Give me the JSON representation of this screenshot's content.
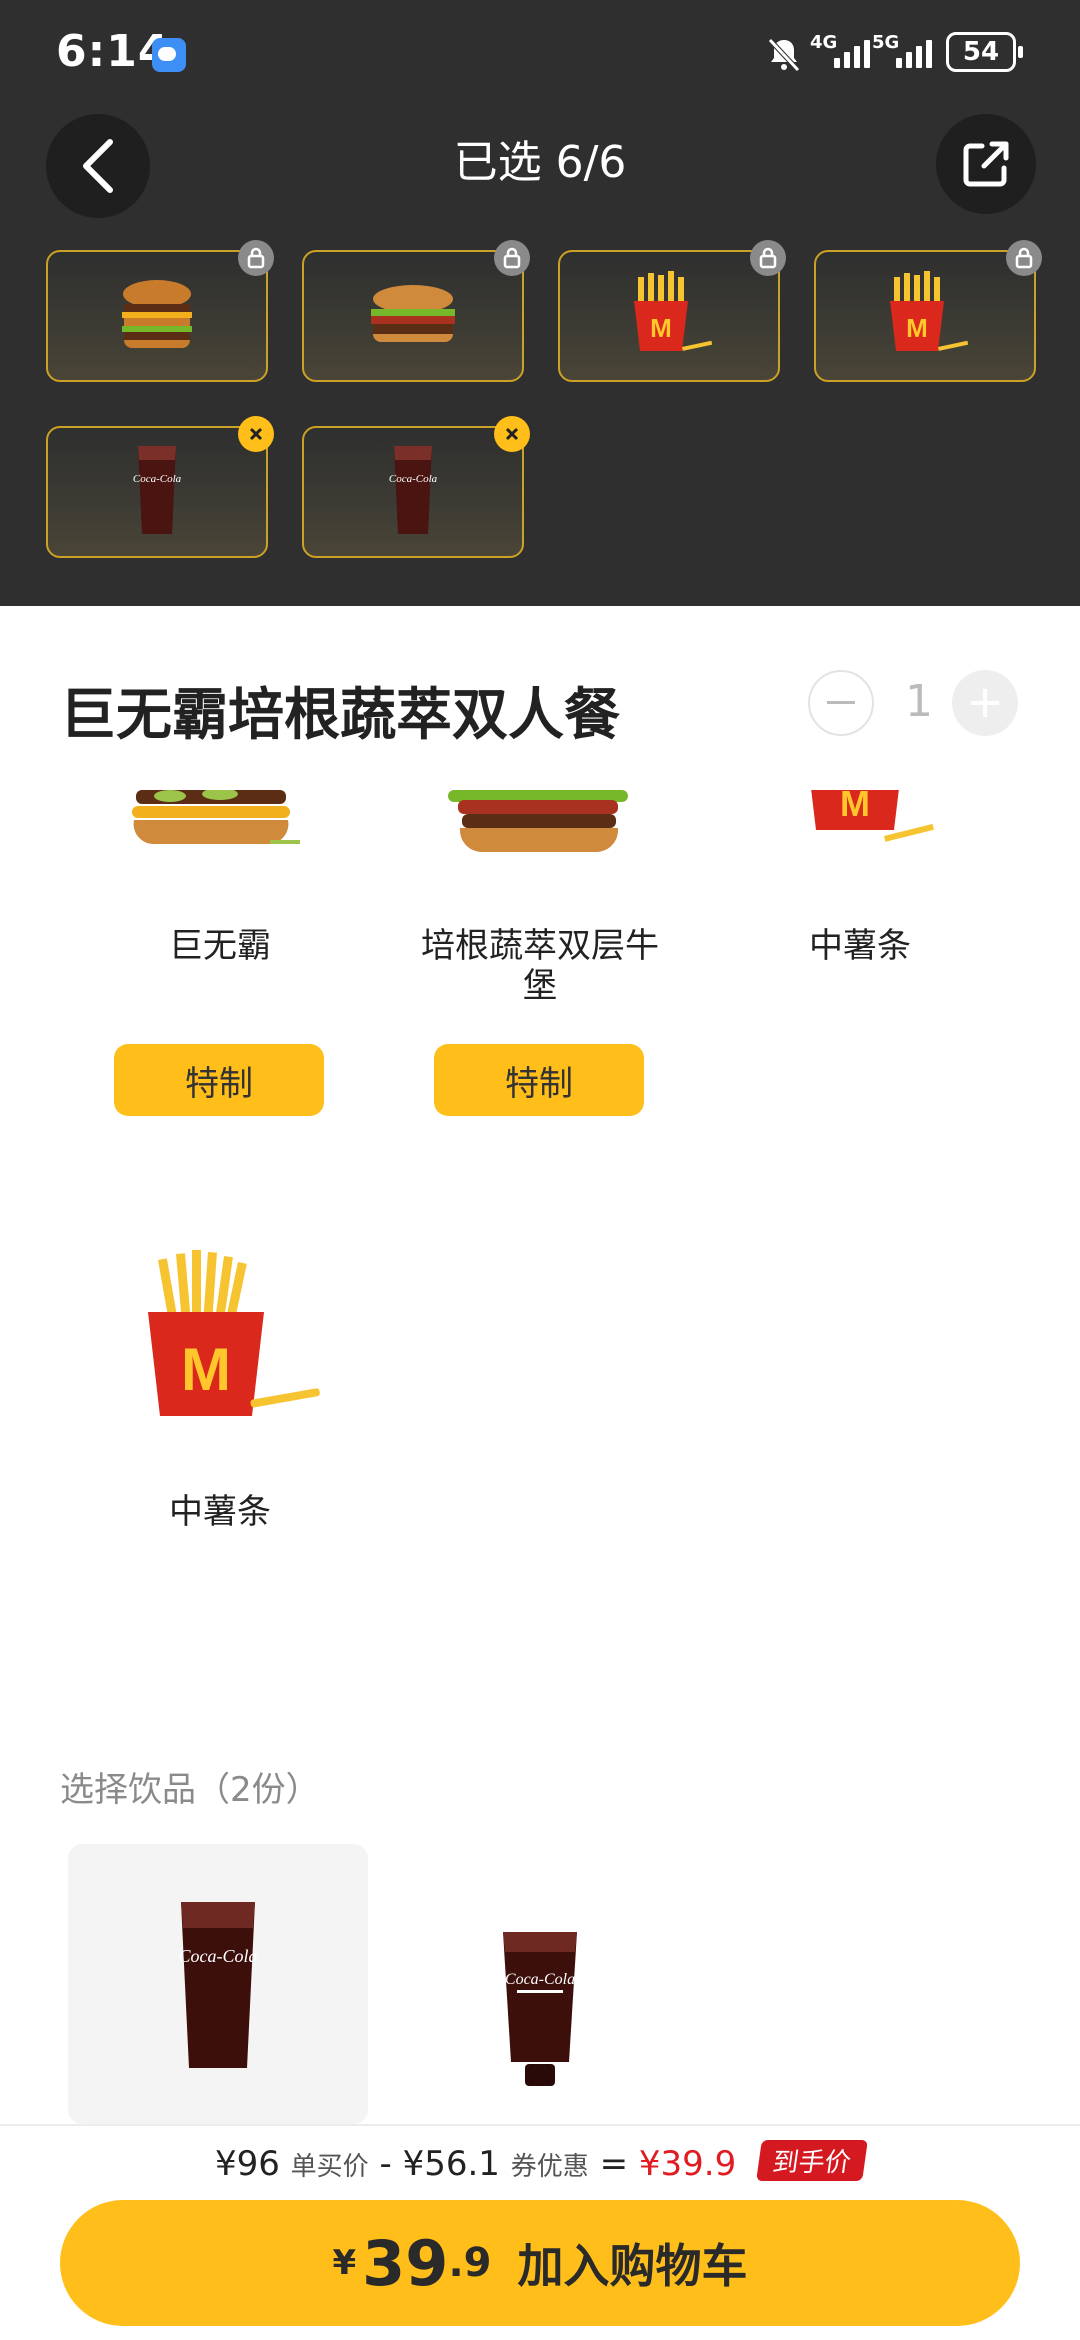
{
  "status_bar": {
    "time": "6:14",
    "network_1": "4G",
    "network_2": "5G",
    "battery": "54"
  },
  "header": {
    "title": "已选 6/6",
    "back_icon": "chevron-left-icon",
    "share_icon": "external-share-icon"
  },
  "selected_chips": [
    {
      "item": "巨无霸",
      "icon": "burger-icon",
      "badge": "lock-icon"
    },
    {
      "item": "培根蔬萃双层牛堡",
      "icon": "burger-icon",
      "badge": "lock-icon"
    },
    {
      "item": "中薯条",
      "icon": "fries-icon",
      "badge": "lock-icon"
    },
    {
      "item": "中薯条",
      "icon": "fries-icon",
      "badge": "lock-icon"
    },
    {
      "item": "可口可乐",
      "icon": "cola-icon",
      "badge": "remove-icon"
    },
    {
      "item": "可口可乐",
      "icon": "cola-icon",
      "badge": "remove-icon"
    }
  ],
  "meal": {
    "title": "巨无霸培根蔬萃双人餐",
    "quantity": "1"
  },
  "items": [
    {
      "name": "巨无霸",
      "button": "特制"
    },
    {
      "name": "培根蔬萃双层牛堡",
      "button": "特制"
    },
    {
      "name": "中薯条"
    },
    {
      "name": "中薯条"
    }
  ],
  "drinks": {
    "title": "选择饮品（2份）"
  },
  "price_summary": {
    "original": "¥96",
    "original_label": "单买价",
    "minus": "-",
    "discount": "¥56.1",
    "discount_label": "券优惠",
    "equals": "=",
    "final": "¥39.9",
    "final_tag": "到手价"
  },
  "cart_button": {
    "currency": "¥",
    "price_int": "39",
    "price_dec": ".9",
    "label": "加入购物车"
  },
  "colors": {
    "accent": "#ffbe1a",
    "header_bg": "#2f2f2f",
    "price_red": "#e11b22"
  }
}
